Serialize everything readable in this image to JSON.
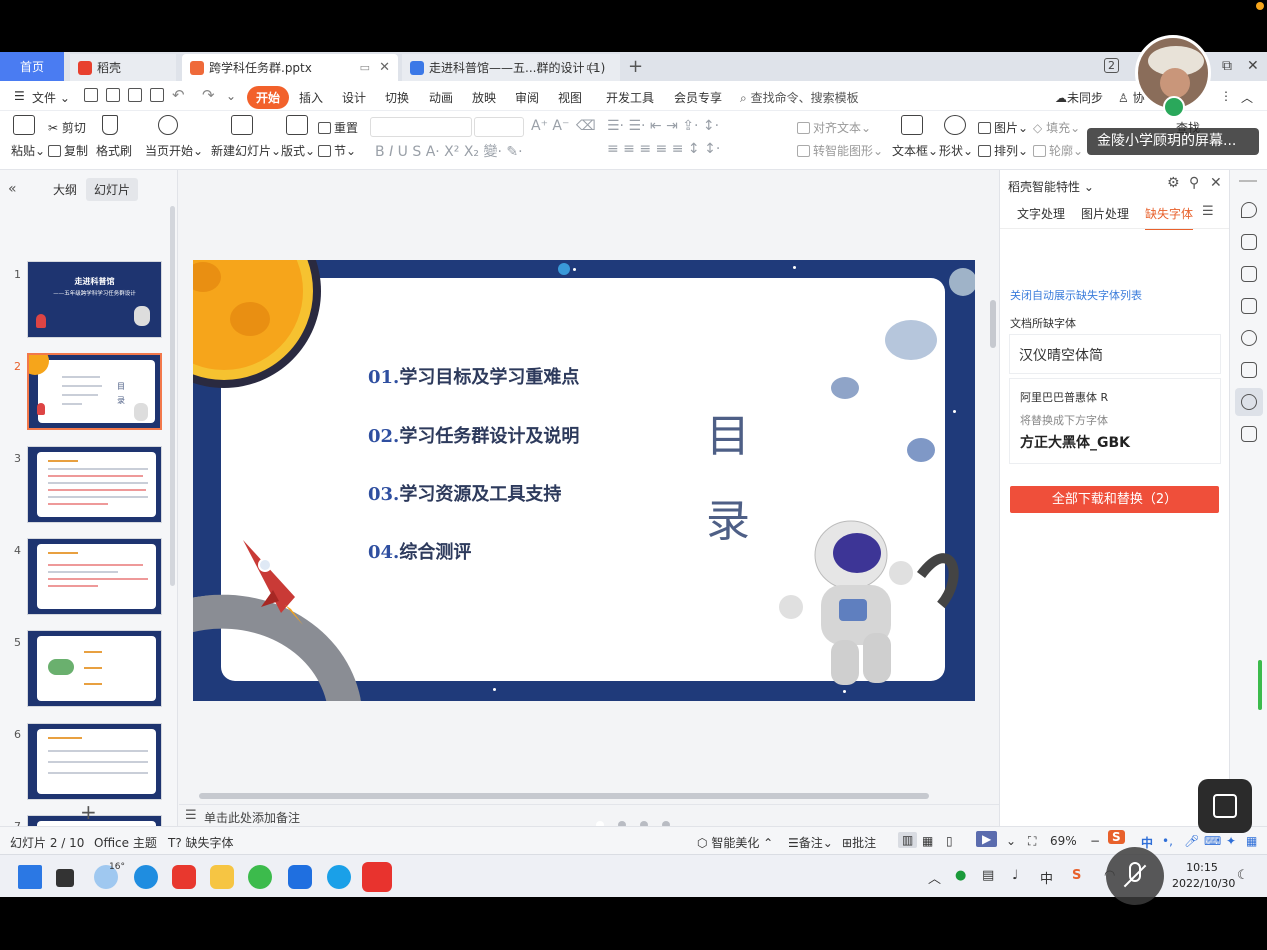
{
  "tabs": {
    "home": "首页",
    "t1": "稻壳",
    "t2": "跨学科任务群.pptx",
    "t3": "走进科普馆——五...群的设计 (1)",
    "plus": "+",
    "close": "✕",
    "badge": "2"
  },
  "menu": {
    "file": "文件",
    "items": [
      "开始",
      "插入",
      "设计",
      "切换",
      "动画",
      "放映",
      "审阅",
      "视图",
      "开发工具",
      "会员专享"
    ],
    "search": "查找命令、搜索模板",
    "sync": "未同步",
    "collab": "协"
  },
  "ribbon": {
    "paste": "粘贴",
    "cut": "剪切",
    "copy": "复制",
    "format_painter": "格式刷",
    "from_current": "当页开始",
    "new_slide": "新建幻灯片",
    "layout": "版式",
    "reset": "重置",
    "section": "节",
    "align_text": "对齐文本",
    "convert_shape": "转智能图形",
    "text_box": "文本框",
    "shape": "形状",
    "picture": "图片",
    "arrange": "排列",
    "fill": "填充",
    "outline": "轮廓",
    "find": "查找"
  },
  "left_panel": {
    "tab_outline": "大纲",
    "tab_slides": "幻灯片",
    "slide_numbers": [
      "1",
      "2",
      "3",
      "4",
      "5",
      "6",
      "7"
    ],
    "thumb1_title": "走进科普馆",
    "thumb1_subtitle": "——五年级跨学科学习任务群设计",
    "thumb2_mu": "目",
    "thumb2_lu": "录",
    "add": "+"
  },
  "slide": {
    "toc": [
      {
        "num": "01.",
        "text": "学习目标及学习重难点"
      },
      {
        "num": "02.",
        "text": "学习任务群设计及说明"
      },
      {
        "num": "03.",
        "text": "学习资源及工具支持"
      },
      {
        "num": "04.",
        "text": "综合测评"
      }
    ],
    "title_top": "目",
    "title_bottom": "录"
  },
  "notes_placeholder": "单击此处添加备注",
  "right_panel": {
    "title": "稻壳智能特性",
    "tabs": [
      "文字处理",
      "图片处理",
      "缺失字体"
    ],
    "close_link": "关闭自动展示缺失字体列表",
    "section_label": "文档所缺字体",
    "missing_font_1": "汉仪晴空体简",
    "missing_font_2": "阿里巴巴普惠体 R",
    "replace_hint": "将替换成下方字体",
    "replacement_font": "方正大黑体_GBK",
    "download_button": "全部下载和替换（2）"
  },
  "status": {
    "slide_pos": "幻灯片 2 / 10",
    "theme": "Office 主题",
    "missing_font": "缺失字体",
    "beautify": "智能美化",
    "notes": "备注",
    "comment": "批注",
    "zoom": "69%",
    "zoom_minus": "−",
    "ime": "中"
  },
  "taskbar": {
    "weather": "16°",
    "time": "10:15",
    "date": "2022/10/30",
    "ime": "中"
  },
  "overlay": {
    "share_label": "金陵小学顾玥的屏幕..."
  },
  "colors": {
    "accent": "#f2612b",
    "home_tab": "#4a7cf2",
    "slide_bg": "#1f3a7a",
    "download_button": "#ef4f3a"
  }
}
